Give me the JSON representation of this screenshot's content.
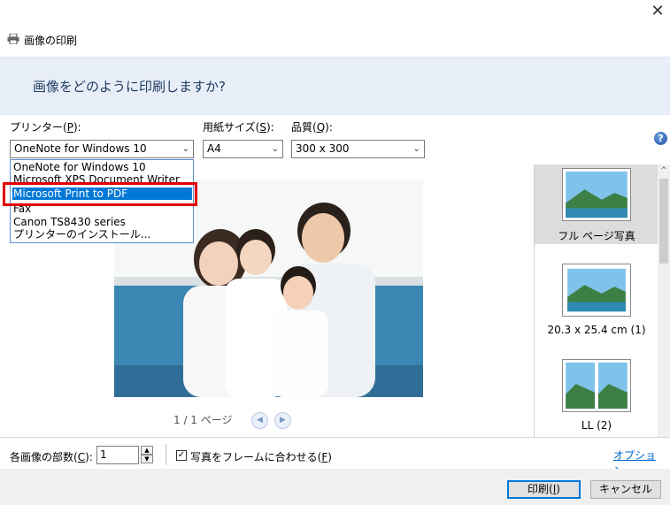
{
  "window": {
    "title": "画像の印刷",
    "close_glyph": "✕",
    "icon": "printer-icon"
  },
  "header": {
    "text": "画像をどのように印刷しますか?"
  },
  "printer": {
    "label_pre": "プリンター(",
    "label_key": "P",
    "label_post": "):",
    "value": "OneNote for Windows 10",
    "options": [
      "OneNote for Windows 10",
      "Microsoft XPS Document Writer",
      "Microsoft Print to PDF",
      "Fax",
      "Canon TS8430 series",
      "プリンターのインストール..."
    ],
    "highlighted": "Microsoft Print to PDF"
  },
  "paper": {
    "label_pre": "用紙サイズ(",
    "label_key": "S",
    "label_post": "):",
    "value": "A4"
  },
  "quality": {
    "label_pre": "品質(",
    "label_key": "Q",
    "label_post": "):",
    "value": "300 x 300"
  },
  "preview": {
    "page_counter": "1 / 1 ページ",
    "prev_glyph": "◀",
    "next_glyph": "▶"
  },
  "layouts": [
    {
      "label": "フル ページ写真",
      "selected": true
    },
    {
      "label": "20.3 x 25.4 cm (1)",
      "selected": false
    },
    {
      "label": "LL (2)",
      "selected": false
    }
  ],
  "bottom": {
    "copies_label_pre": "各画像の部数(",
    "copies_label_key": "C",
    "copies_label_post": "):",
    "copies_value": "1",
    "fit_label_pre": "写真をフレームに合わせる(",
    "fit_label_key": "F",
    "fit_label_post": ")",
    "fit_checked": true,
    "check_glyph": "✓",
    "options_link": "オプション..."
  },
  "buttons": {
    "print_pre": "印刷(",
    "print_key": "I",
    "print_post": ")",
    "cancel": "キャンセル"
  },
  "colors": {
    "selection": "#0078d7",
    "highlight_outline": "#e00000",
    "header_band": "#e8eef8",
    "link": "#0066cc"
  }
}
